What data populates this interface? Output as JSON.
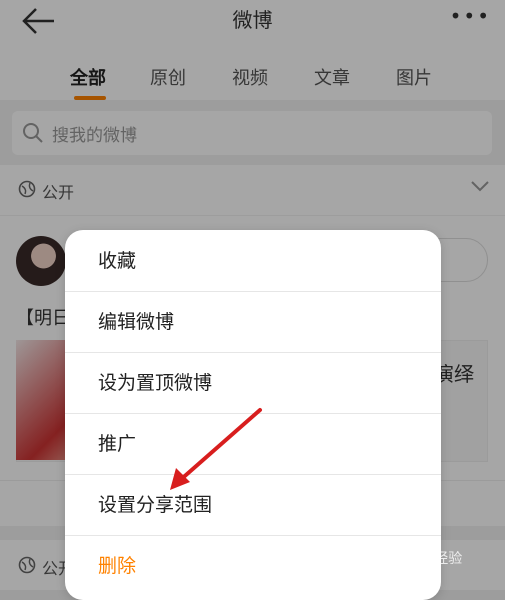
{
  "header": {
    "title": "微博",
    "back_icon": "back-arrow-icon",
    "more_icon": "more-dots-icon"
  },
  "tabs": [
    {
      "label": "全部",
      "active": true
    },
    {
      "label": "原创"
    },
    {
      "label": "视频"
    },
    {
      "label": "文章"
    },
    {
      "label": "图片"
    }
  ],
  "search": {
    "placeholder": "搜我的微博",
    "icon": "search-icon"
  },
  "section": {
    "visibility_label": "公开",
    "icon": "globe-icon",
    "chevron": "chevron-down-icon"
  },
  "post": {
    "text_prefix": "【明日",
    "right_text": "演绎"
  },
  "menu": {
    "items": [
      {
        "label": "收藏"
      },
      {
        "label": "编辑微博"
      },
      {
        "label": "设为置顶微博"
      },
      {
        "label": "推广"
      },
      {
        "label": "设置分享范围"
      },
      {
        "label": "删除",
        "danger": true
      }
    ]
  },
  "colors": {
    "accent": "#ff8200",
    "arrow": "#d81e1e"
  },
  "watermark": "Baidu 经验"
}
